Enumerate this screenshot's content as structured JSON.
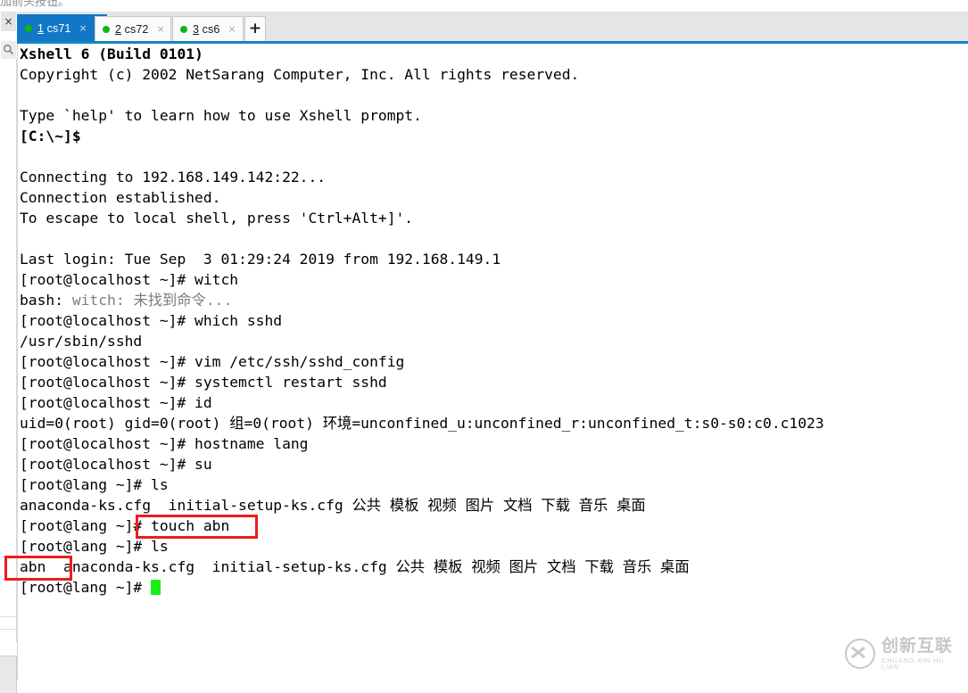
{
  "top_strip": {
    "cut_text": "加前头按钮。"
  },
  "tabbar": {
    "close_all_icon": "×",
    "add_tab_label": "+",
    "tabs": [
      {
        "num": "1",
        "name": "cs71",
        "close_icon": "×",
        "status": "connected",
        "active": true
      },
      {
        "num": "2",
        "name": "cs72",
        "close_icon": "×",
        "status": "connected",
        "active": false
      },
      {
        "num": "3",
        "name": "cs6",
        "close_icon": "×",
        "status": "connected",
        "active": false
      }
    ],
    "accent_color": "#1277c6",
    "underline_color": "#1384c8",
    "status_dot_color": "#14b414"
  },
  "left_rail": {
    "close_icon": "×",
    "search_icon": "search-icon"
  },
  "terminal": {
    "background": "#ffffff",
    "foreground": "#000000",
    "cursor_color": "#19f019",
    "lines": [
      {
        "text": "Xshell 6 (Build 0101)",
        "bold": true
      },
      {
        "text": "Copyright (c) 2002 NetSarang Computer, Inc. All rights reserved."
      },
      {
        "text": ""
      },
      {
        "text": "Type `help' to learn how to use Xshell prompt."
      },
      {
        "text": "[C:\\~]$",
        "bold": true
      },
      {
        "text": ""
      },
      {
        "text": "Connecting to 192.168.149.142:22..."
      },
      {
        "text": "Connection established."
      },
      {
        "text": "To escape to local shell, press 'Ctrl+Alt+]'."
      },
      {
        "text": ""
      },
      {
        "text": "Last login: Tue Sep  3 01:29:24 2019 from 192.168.149.1"
      },
      {
        "text": "[root@localhost ~]# witch"
      },
      {
        "text": "bash: witch: 未找到命令...",
        "gray_tail": true
      },
      {
        "text": "[root@localhost ~]# which sshd"
      },
      {
        "text": "/usr/sbin/sshd"
      },
      {
        "text": "[root@localhost ~]# vim /etc/ssh/sshd_config"
      },
      {
        "text": "[root@localhost ~]# systemctl restart sshd"
      },
      {
        "text": "[root@localhost ~]# id"
      },
      {
        "text": "uid=0(root) gid=0(root) 组=0(root) 环境=unconfined_u:unconfined_r:unconfined_t:s0-s0:c0.c1023"
      },
      {
        "text": "[root@localhost ~]# hostname lang"
      },
      {
        "text": "[root@localhost ~]# su"
      },
      {
        "text": "[root@lang ~]# ls"
      },
      {
        "text": "anaconda-ks.cfg  initial-setup-ks.cfg 公共 模板 视频 图片 文档 下载 音乐 桌面"
      },
      {
        "text": "[root@lang ~]# touch abn"
      },
      {
        "text": "[root@lang ~]# ls"
      },
      {
        "text": "abn  anaconda-ks.cfg  initial-setup-ks.cfg 公共 模板 视频 图片 文档 下载 音乐 桌面"
      },
      {
        "text": "[root@lang ~]# ",
        "cursor": true
      }
    ]
  },
  "annotations": {
    "color": "#ee1c1c",
    "boxes": [
      {
        "id": "touch-command",
        "target": "# touch abn"
      },
      {
        "id": "abn-file",
        "target": "abn"
      }
    ]
  },
  "watermark": {
    "chinese": "创新互联",
    "pinyin": "CHUANG XIN HU LIAN",
    "color": "#c2c2c2"
  }
}
